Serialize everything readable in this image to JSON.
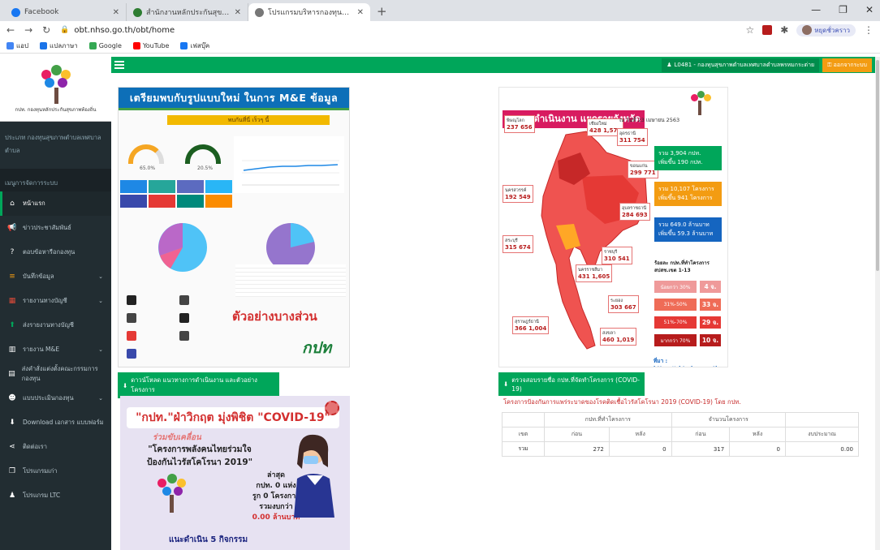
{
  "browser": {
    "tabs": [
      {
        "title": "Facebook",
        "color": "#1877f2"
      },
      {
        "title": "สำนักงานหลักประกันสุขภาพแห่งชาติ",
        "color": "#2e7d32"
      },
      {
        "title": "โปรแกรมบริหารกองทุนหลักประกันสุขภาพ",
        "color": "#555555"
      }
    ],
    "url": "obt.nhso.go.th/obt/home",
    "profile_label": "หยุดชั่วคราว",
    "bookmarks": [
      {
        "label": "แอป",
        "color": "#4285f4"
      },
      {
        "label": "แปลภาษา",
        "color": "#1a73e8"
      },
      {
        "label": "Google",
        "color": "#34a853"
      },
      {
        "label": "YouTube",
        "color": "#ff0000"
      },
      {
        "label": "เฟสบุ๊ค",
        "color": "#1877f2"
      }
    ]
  },
  "sidebar": {
    "logo_text": "กปท. กองทุนหลักประกันสุขภาพท้องถิ่น",
    "org_name": "ประเภท กองทุนสุขภาพตำบลเทศบาลตำบล",
    "menu_heading": "เมนูการจัดการระบบ",
    "items": [
      {
        "label": "หน้าแรก",
        "icon": "home-icon",
        "glyph": "⌂",
        "color": "#ffffff",
        "caret": false,
        "active": true
      },
      {
        "label": "ข่าวประชาสัมพันธ์",
        "icon": "megaphone-icon",
        "glyph": "📢",
        "color": "#ffffff",
        "caret": false,
        "active": false
      },
      {
        "label": "ตอบข้อหารือกองทุน",
        "icon": "question-icon",
        "glyph": "?",
        "color": "#ffffff",
        "caret": false,
        "active": false
      },
      {
        "label": "บันทึกข้อมูล",
        "icon": "database-icon",
        "glyph": "≡",
        "color": "#f39c12",
        "caret": true,
        "active": false
      },
      {
        "label": "รายงานทางบัญชี",
        "icon": "table-icon",
        "glyph": "▦",
        "color": "#dd4b39",
        "caret": true,
        "active": false
      },
      {
        "label": "ส่งรายงานทางบัญชี",
        "icon": "upload-icon",
        "glyph": "⬆",
        "color": "#00a65a",
        "caret": false,
        "active": false
      },
      {
        "label": "รายงาน M&E",
        "icon": "chart-icon",
        "glyph": "▥",
        "color": "#ffffff",
        "caret": true,
        "active": false
      },
      {
        "label": "ส่งคำสั่งแต่งตั้งคณะกรรมการกองทุน",
        "icon": "file-icon",
        "glyph": "▤",
        "color": "#ffffff",
        "caret": false,
        "active": false
      },
      {
        "label": "แบบประเมินกองทุน",
        "icon": "users-icon",
        "glyph": "☻",
        "color": "#ffffff",
        "caret": true,
        "active": false
      },
      {
        "label": "Download เอกสาร แบบฟอร์ม",
        "icon": "download-icon",
        "glyph": "⬇",
        "color": "#ffffff",
        "caret": false,
        "active": false
      },
      {
        "label": "ติดต่อเรา",
        "icon": "share-icon",
        "glyph": "⋖",
        "color": "#ffffff",
        "caret": false,
        "active": false
      },
      {
        "label": "โปรแกรมเก่า",
        "icon": "copy-icon",
        "glyph": "❐",
        "color": "#ffffff",
        "caret": false,
        "active": false
      },
      {
        "label": "โปรแกรม LTC",
        "icon": "person-icon",
        "glyph": "♟",
        "color": "#ffffff",
        "caret": false,
        "active": false
      }
    ]
  },
  "header": {
    "user_label": "L0481 - กองทุนสุขภาพตำบลเทศบาลตำบลพรหมกระต่าย",
    "logout_label": "ออกจากระบบ"
  },
  "panel_left": {
    "banner": "เตรียมพบกับรูปแบบใหม่ ในการ M&E ข้อมูล",
    "subhead": "พบกันที่นี่ เร็วๆ นี้",
    "gauge1": "65.0%",
    "gauge2": "20.5%",
    "sample_text": "ตัวอย่างบางส่วน",
    "brand": "กปท",
    "download_label": "ดาวน์โหลด แนวทางการดำเนินงาน และตัวอย่างโครงการ"
  },
  "panel_right": {
    "banner": "ผลการดำเนินงาน แยกรายจังหวัด",
    "asof": "ณ วันที่ 23 เมษายน 2563",
    "stats": [
      {
        "line1": "รวม 3,904 กปท.",
        "line2": "เพิ่มขึ้น 190 กปท.",
        "color": "#00a65a"
      },
      {
        "line1": "รวม 10,107 โครงการ",
        "line2": "เพิ่มขึ้น 941 โครงการ",
        "color": "#f39c12"
      },
      {
        "line1": "รวม 649.0 ล้านบาท",
        "line2": "เพิ่มขึ้น 59.3 ล้านบาท",
        "color": "#1565c0"
      }
    ],
    "level_title": "ร้อยละ กปท.ที่ทำโครงการ สปสช.เขต 1-13",
    "levels": [
      {
        "range": "น้อยกว่า 30%",
        "count": "4 จ.",
        "color": "#ef9a9a"
      },
      {
        "range": "31%-50%",
        "count": "33 จ.",
        "color": "#ef6c57"
      },
      {
        "range": "51%-70%",
        "count": "29 จ.",
        "color": "#e53935"
      },
      {
        "range": "มากกว่า 70%",
        "count": "10 จ.",
        "color": "#b71c1c"
      }
    ],
    "source": "ที่มา : https://obt.nhso.go.th",
    "callouts": [
      {
        "name": "พิษณุโลก",
        "v1": "237",
        "v2": "656"
      },
      {
        "name": "เชียงใหม่",
        "v1": "428",
        "v2": "1,574"
      },
      {
        "name": "อุดรธานี",
        "v1": "311",
        "v2": "754"
      },
      {
        "name": "ขอนแก่น",
        "v1": "299",
        "v2": "771"
      },
      {
        "name": "นครสวรรค์",
        "v1": "192",
        "v2": "549"
      },
      {
        "name": "อุบลราชธานี",
        "v1": "284",
        "v2": "693"
      },
      {
        "name": "สระบุรี",
        "v1": "315",
        "v2": "674"
      },
      {
        "name": "นครราชสีมา",
        "v1": "431",
        "v2": "1,605"
      },
      {
        "name": "ราชบุรี",
        "v1": "310",
        "v2": "541"
      },
      {
        "name": "ระยอง",
        "v1": "303",
        "v2": "667"
      },
      {
        "name": "สุราษฎร์ธานี",
        "v1": "366",
        "v2": "1,004"
      },
      {
        "name": "สงขลา",
        "v1": "460",
        "v2": "1,019"
      }
    ],
    "check_label": "ตรวจสอบรายชื่อ กปท.ที่จัดทำโครงการ (COVID-19)"
  },
  "covid_poster": {
    "title": "\"กปท.\"ฝ่าวิกฤต มุ่งพิชิต \"COVID-19\"",
    "sub1": "ร่วมขับเคลื่อน",
    "sub2": "\"โครงการพลังคนไทยร่วมใจ ป้องกันไวรัสโคโรนา 2019\"",
    "latest1": "ล่าสุด",
    "latest2": "กปท. 0 แห่ง",
    "latest3": "รูก 0 โครงการ",
    "latest4": "รวมงบกว่า",
    "latest5": "0.00 ล้านบาท",
    "do5": "แนะดำเนิน 5 กิจกรรม"
  },
  "covid_table": {
    "caption": "โครงการป้องกันการแพร่ระบาดของโรคติดเชื้อไวรัสโคโรนา 2019 (COVID-19) โดย กปท.",
    "group1": "กปท.ที่ทำโครงการ",
    "group2": "จำนวนโครงการ",
    "col_zone": "เขต",
    "col_before": "ก่อน",
    "col_after": "หลัง",
    "col_budget": "งบประมาณ",
    "row": {
      "zone": "รวม",
      "fund_before": "272",
      "fund_after": "0",
      "proj_before": "317",
      "proj_after": "0",
      "budget": "0.00"
    }
  }
}
